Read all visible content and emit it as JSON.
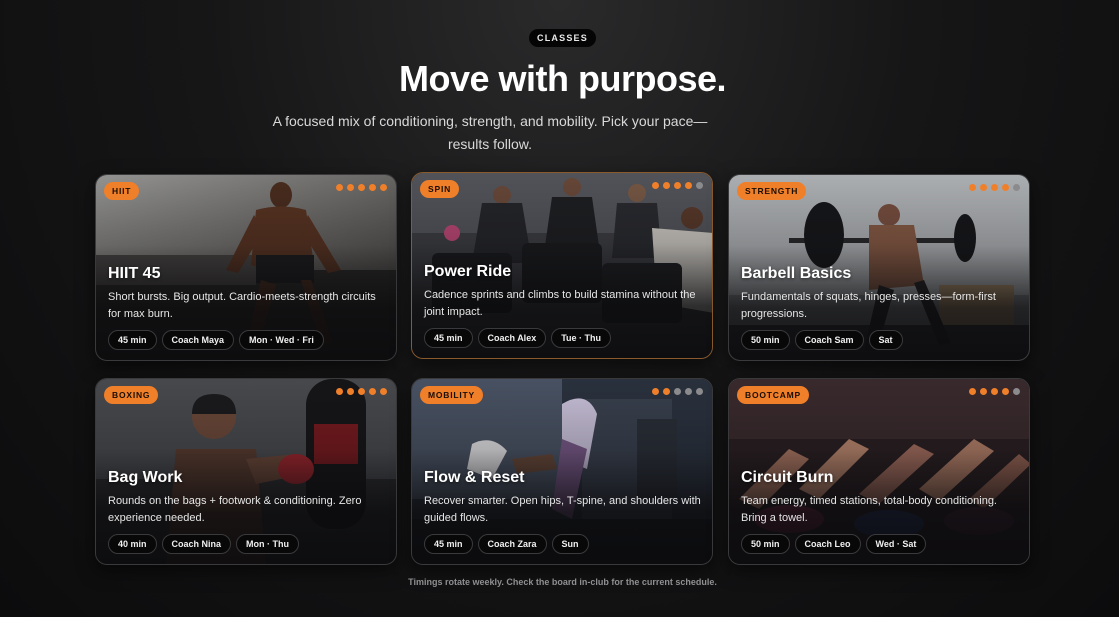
{
  "eyebrow": "CLASSES",
  "title": "Move with purpose.",
  "subtitle": "A focused mix of conditioning, strength, and mobility. Pick your pace—results follow.",
  "footnote": "Timings rotate weekly. Check the board in-club for the current schedule.",
  "colors": {
    "accent": "#f07f2a",
    "background": "#141415",
    "dot_inactive": "#8b8b8e"
  },
  "cards": [
    {
      "tag": "HIIT",
      "title": "HIIT 45",
      "description": "Short bursts. Big output. Cardio-meets-strength circuits for max burn.",
      "duration": "45 min",
      "coach": "Coach Maya",
      "days": "Mon · Wed · Fri",
      "intensity": 5,
      "intensity_max": 5
    },
    {
      "tag": "SPIN",
      "title": "Power Ride",
      "description": "Cadence sprints and climbs to build stamina without the joint impact.",
      "duration": "45 min",
      "coach": "Coach Alex",
      "days": "Tue · Thu",
      "intensity": 4,
      "intensity_max": 5
    },
    {
      "tag": "STRENGTH",
      "title": "Barbell Basics",
      "description": "Fundamentals of squats, hinges, presses—form-first progressions.",
      "duration": "50 min",
      "coach": "Coach Sam",
      "days": "Sat",
      "intensity": 4,
      "intensity_max": 5
    },
    {
      "tag": "BOXING",
      "title": "Bag Work",
      "description": "Rounds on the bags + footwork & conditioning. Zero experience needed.",
      "duration": "40 min",
      "coach": "Coach Nina",
      "days": "Mon · Thu",
      "intensity": 5,
      "intensity_max": 5
    },
    {
      "tag": "MOBILITY",
      "title": "Flow & Reset",
      "description": "Recover smarter. Open hips, T-spine, and shoulders with guided flows.",
      "duration": "45 min",
      "coach": "Coach Zara",
      "days": "Sun",
      "intensity": 2,
      "intensity_max": 5
    },
    {
      "tag": "BOOTCAMP",
      "title": "Circuit Burn",
      "description": "Team energy, timed stations, total-body conditioning. Bring a towel.",
      "duration": "50 min",
      "coach": "Coach Leo",
      "days": "Wed · Sat",
      "intensity": 4,
      "intensity_max": 5
    }
  ]
}
